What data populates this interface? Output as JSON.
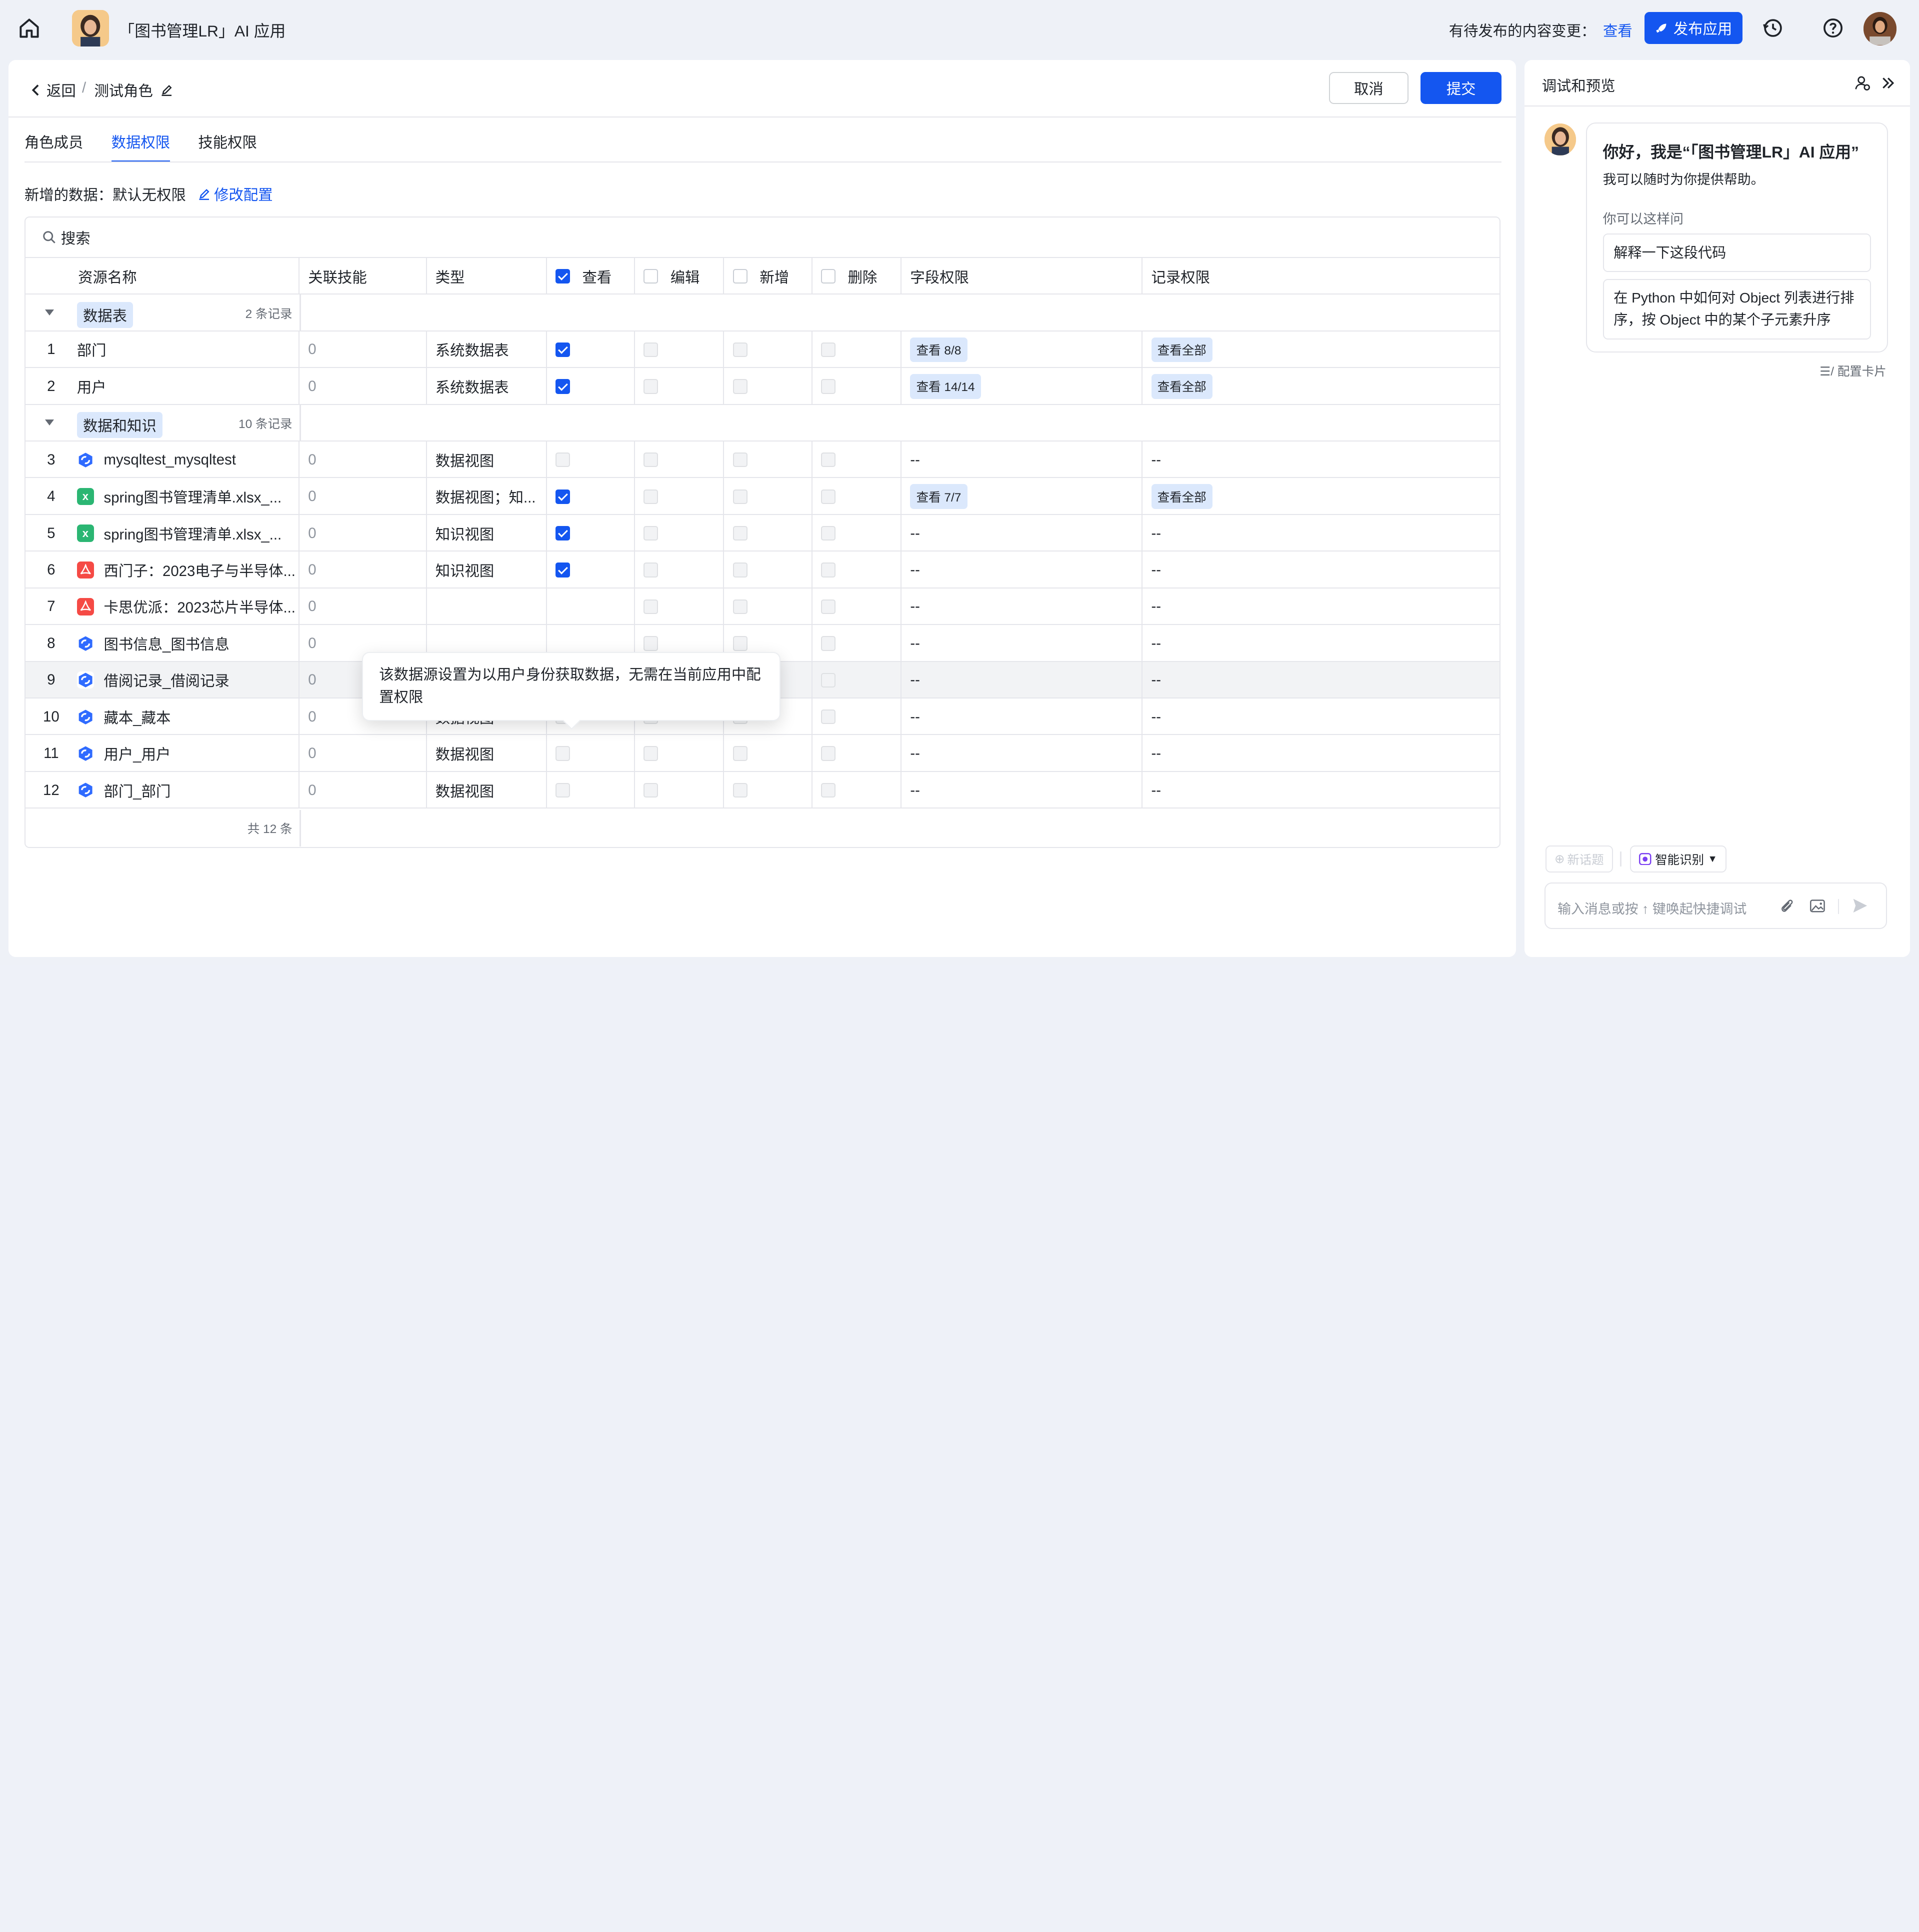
{
  "header": {
    "app_title": "「图书管理LR」AI 应用",
    "pending_label": "有待发布的内容变更：",
    "pending_link": "查看",
    "publish_label": "发布应用"
  },
  "page": {
    "back_label": "返回",
    "crumb_sep": "/",
    "role_name": "测试角色",
    "cancel_label": "取消",
    "submit_label": "提交"
  },
  "tabs": [
    {
      "label": "角色成员",
      "active": false
    },
    {
      "label": "数据权限",
      "active": true
    },
    {
      "label": "技能权限",
      "active": false
    }
  ],
  "new_data": {
    "label": "新增的数据：默认无权限",
    "edit_label": "修改配置"
  },
  "search": {
    "placeholder": "搜索"
  },
  "columns": {
    "name": "资源名称",
    "skill": "关联技能",
    "type": "类型",
    "view": "查看",
    "edit": "编辑",
    "add": "新增",
    "delete": "删除",
    "field": "字段权限",
    "record": "记录权限"
  },
  "header_checks": {
    "view": true,
    "edit": false,
    "add": false,
    "delete": false
  },
  "groups": [
    {
      "label": "数据表",
      "count": "2 条记录"
    },
    {
      "label": "数据和知识",
      "count": "10 条记录"
    }
  ],
  "rows": [
    {
      "no": "1",
      "icon": "none",
      "name": "部门",
      "skill": "0",
      "type": "系统数据表",
      "view": "on",
      "field": "查看 8/8",
      "record": "查看全部"
    },
    {
      "no": "2",
      "icon": "none",
      "name": "用户",
      "skill": "0",
      "type": "系统数据表",
      "view": "on",
      "field": "查看 14/14",
      "record": "查看全部"
    },
    {
      "no": "3",
      "icon": "view",
      "name": "mysqltest_mysqltest",
      "skill": "0",
      "type": "数据视图",
      "view": "dis",
      "field": "--",
      "record": "--"
    },
    {
      "no": "4",
      "icon": "xls",
      "name": "spring图书管理清单.xlsx_...",
      "skill": "0",
      "type": "数据视图；知...",
      "view": "on",
      "field": "查看 7/7",
      "record": "查看全部"
    },
    {
      "no": "5",
      "icon": "xls",
      "name": "spring图书管理清单.xlsx_...",
      "skill": "0",
      "type": "知识视图",
      "view": "on",
      "field": "--",
      "record": "--"
    },
    {
      "no": "6",
      "icon": "pdf",
      "name": "西门子：2023电子与半导体...",
      "skill": "0",
      "type": "知识视图",
      "view": "on",
      "field": "--",
      "record": "--"
    },
    {
      "no": "7",
      "icon": "pdf",
      "name": "卡思优派：2023芯片半导体...",
      "skill": "0",
      "type": "",
      "view": "hidden",
      "field": "--",
      "record": "--"
    },
    {
      "no": "8",
      "icon": "view",
      "name": "图书信息_图书信息",
      "skill": "0",
      "type": "",
      "view": "hidden",
      "field": "--",
      "record": "--"
    },
    {
      "no": "9",
      "icon": "view",
      "name": "借阅记录_借阅记录",
      "skill": "0",
      "type": "数据视图",
      "view": "dis",
      "field": "--",
      "record": "--"
    },
    {
      "no": "10",
      "icon": "view",
      "name": "藏本_藏本",
      "skill": "0",
      "type": "数据视图",
      "view": "dis",
      "field": "--",
      "record": "--"
    },
    {
      "no": "11",
      "icon": "view",
      "name": "用户_用户",
      "skill": "0",
      "type": "数据视图",
      "view": "dis",
      "field": "--",
      "record": "--"
    },
    {
      "no": "12",
      "icon": "view",
      "name": "部门_部门",
      "skill": "0",
      "type": "数据视图",
      "view": "dis",
      "field": "--",
      "record": "--"
    }
  ],
  "total_label": "共 12 条",
  "tooltip": "该数据源设置为以用户身份获取数据，无需在当前应用中配置权限",
  "side": {
    "title": "调试和预览",
    "greet_title": "你好，我是“「图书管理LR」AI 应用”",
    "greet_sub": "我可以随时为你提供帮助。",
    "hint": "你可以这样问",
    "suggestions": [
      "解释一下这段代码",
      "在 Python 中如何对 Object 列表进行排序，按 Object 中的某个子元素升序"
    ],
    "config_card": "配置卡片",
    "new_topic": "新话题",
    "smart": "智能识别",
    "input_placeholder": "输入消息或按 ↑ 键唤起快捷调试"
  },
  "colors": {
    "accent": "#1456f0",
    "tag_bg": "#dbe8fc",
    "border": "#e5e6eb"
  }
}
